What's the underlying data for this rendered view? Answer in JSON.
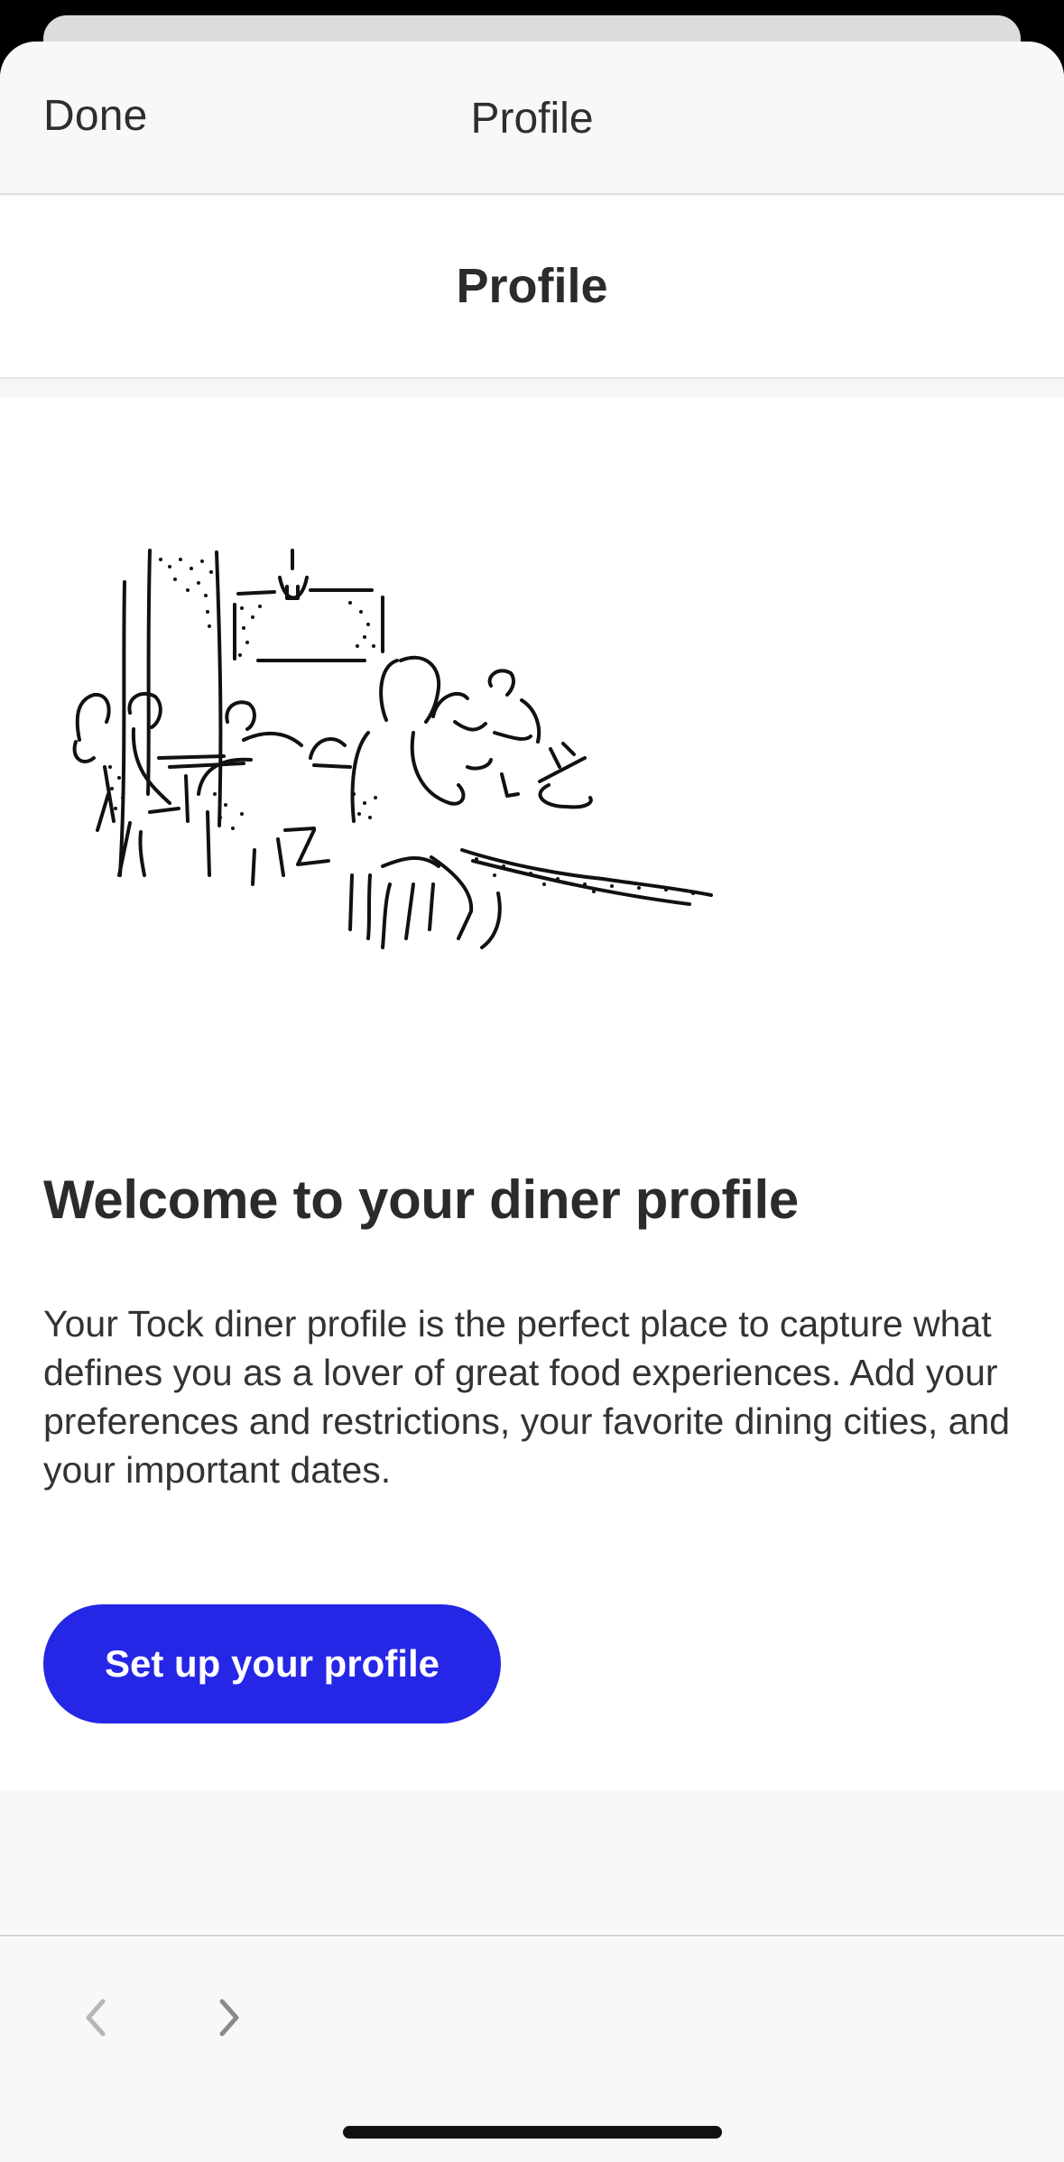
{
  "sheet": {
    "nav": {
      "done_label": "Done",
      "title": "Profile"
    },
    "page_title": "Profile"
  },
  "welcome": {
    "heading": "Welcome to your diner profile",
    "description": "Your Tock diner profile is the perfect place to capture what defines you as a lover of great food experiences. Add your preferences and restrictions, your favorite dining cities, and your important dates.",
    "setup_button_label": "Set up your profile",
    "illustration_icon": "diners-at-bar-illustration"
  },
  "toolbar": {
    "back_icon": "chevron-left-icon",
    "forward_icon": "chevron-right-icon"
  },
  "colors": {
    "accent": "#2626e6",
    "text": "#2b2b2b",
    "sheet_background": "#f8f8f8",
    "disabled_icon": "#b5b5b5",
    "enabled_icon": "#8a8a8a"
  }
}
